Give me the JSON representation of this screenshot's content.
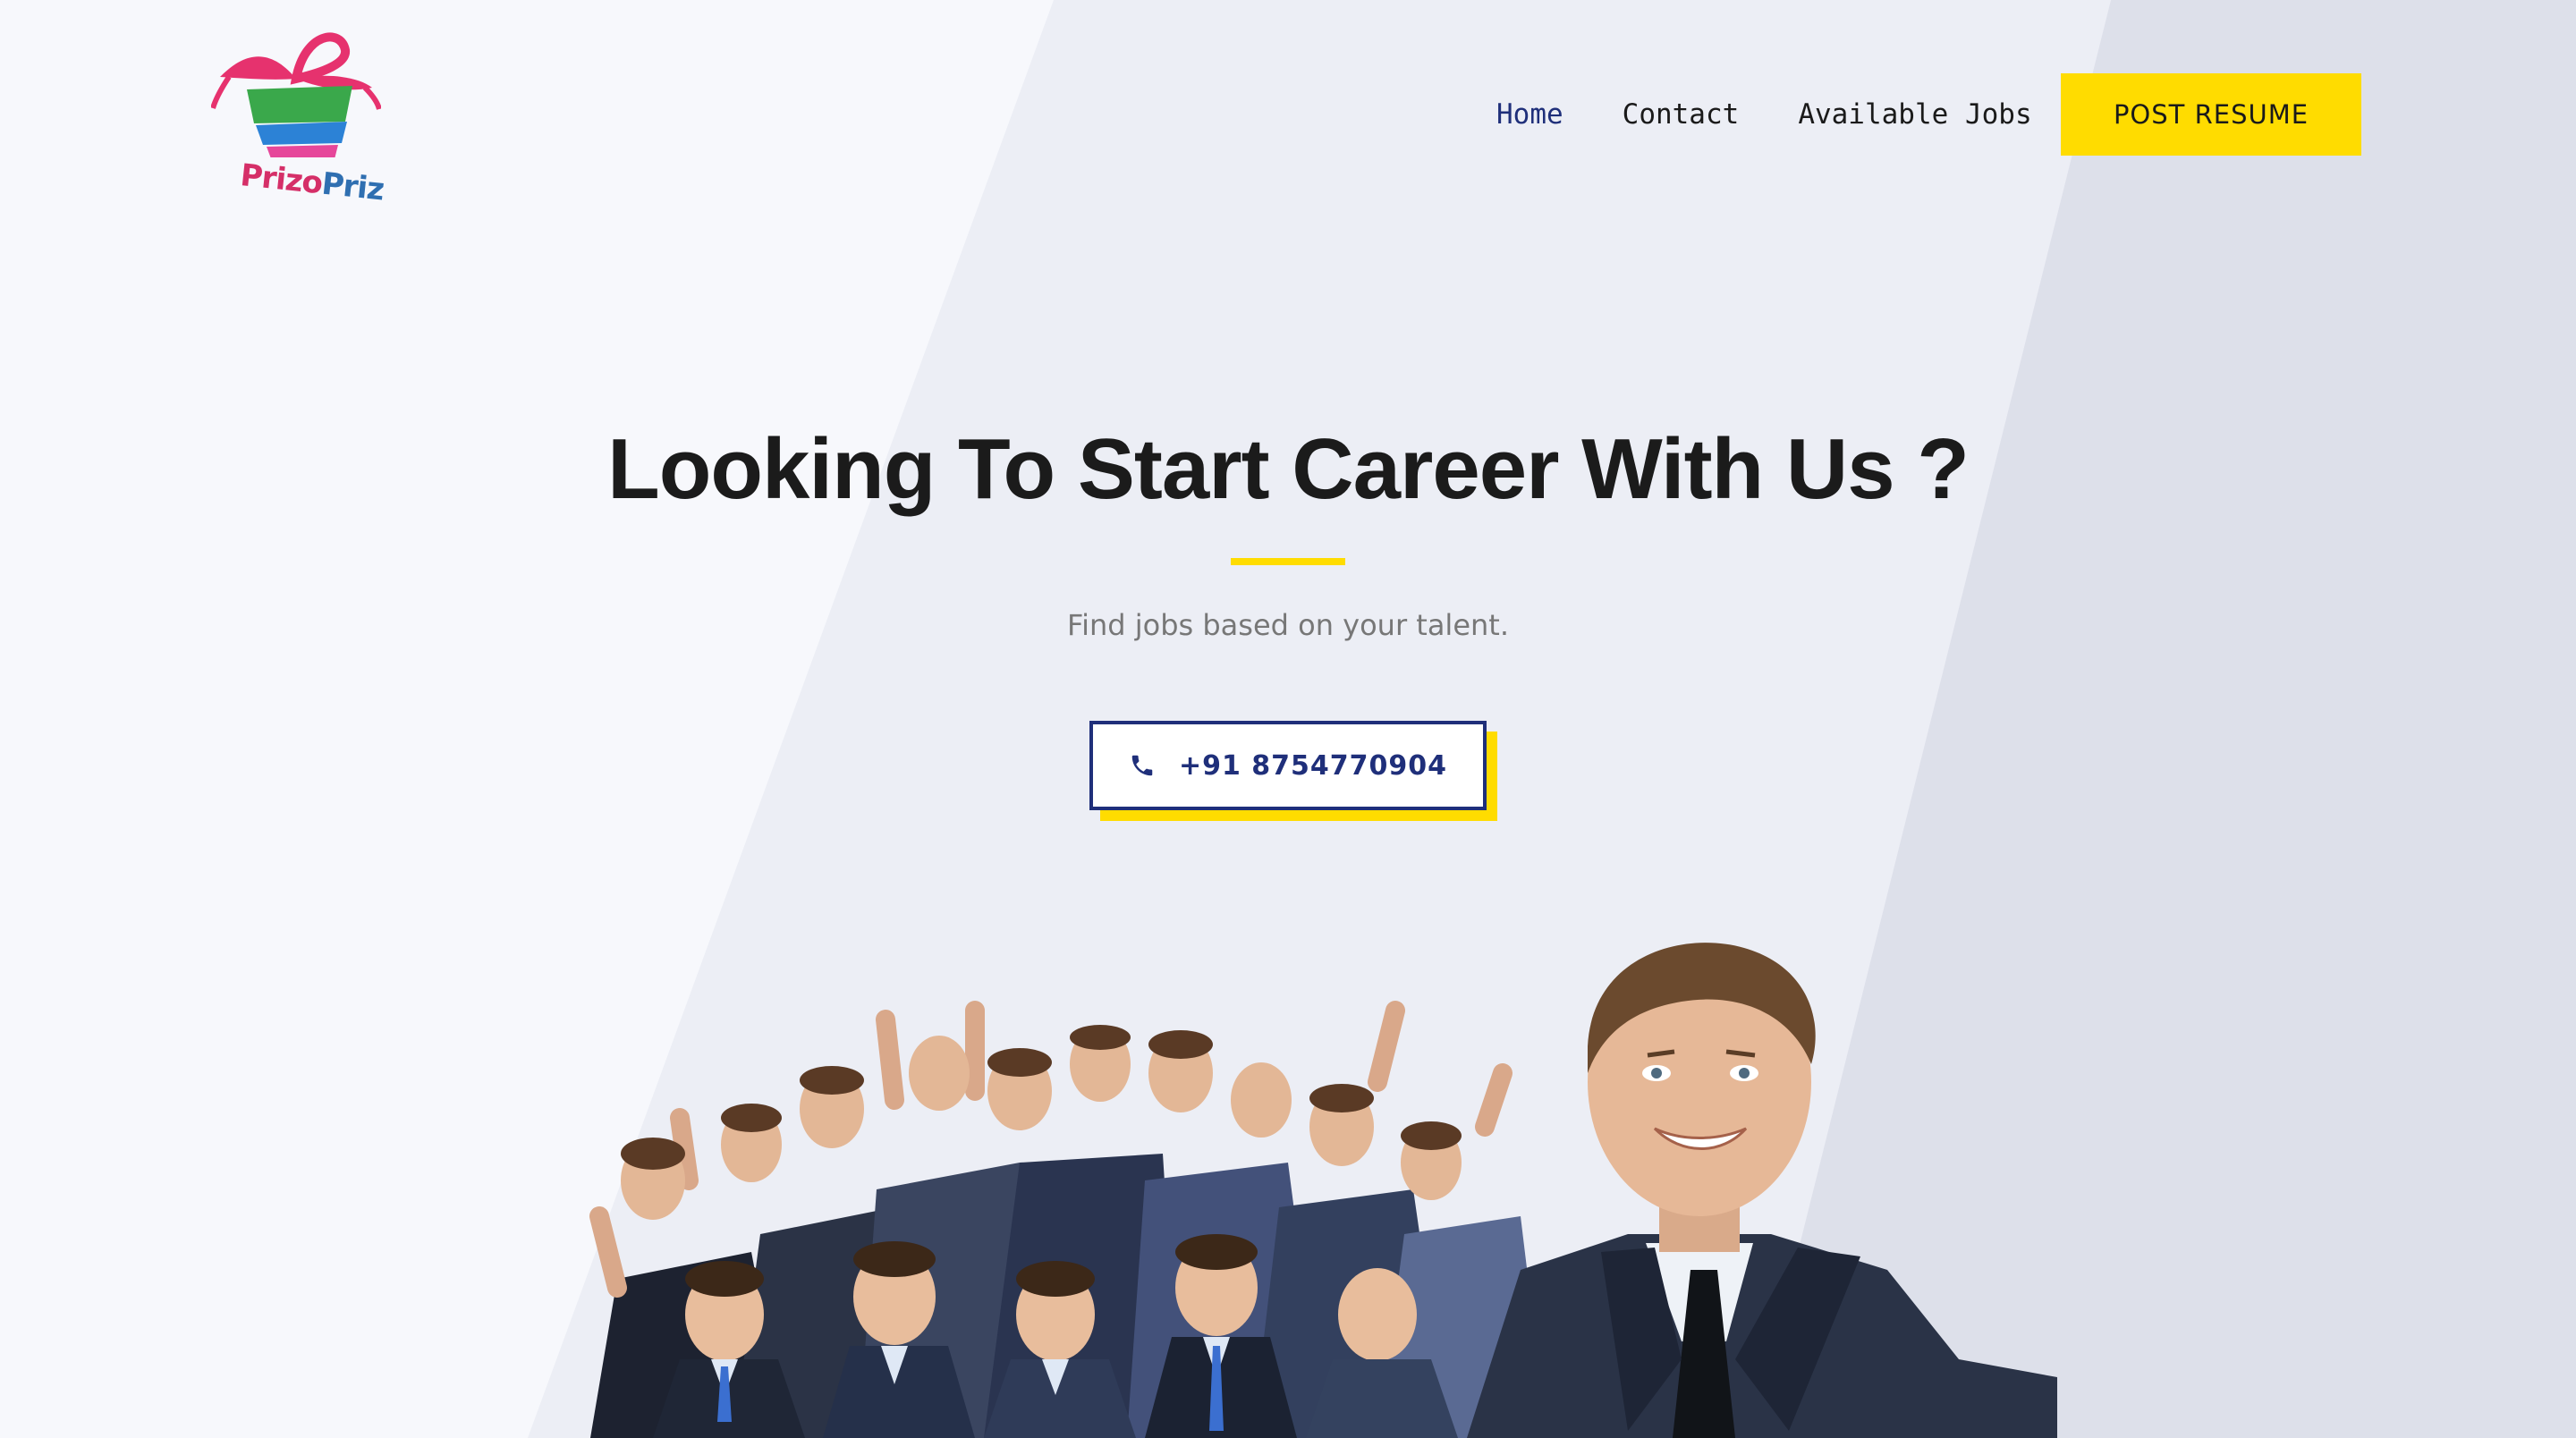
{
  "colors": {
    "accent": "#ffdc00",
    "primary": "#1f2f7a",
    "text": "#1b1b1b",
    "muted": "#777777",
    "background_left": "#f7f8fc",
    "background_mid": "#eceef5",
    "background_right": "#dde0ea"
  },
  "logo": {
    "part1": "Prizo",
    "part2": "Priz",
    "icon": "gift-box-icon"
  },
  "nav": {
    "items": [
      {
        "label": "Home",
        "active": true
      },
      {
        "label": "Contact",
        "active": false
      },
      {
        "label": "Available Jobs",
        "active": false
      }
    ],
    "cta_label": "POST RESUME"
  },
  "hero": {
    "title": "Looking To Start Career With Us ?",
    "subtitle": "Find jobs based on your talent.",
    "phone_label": "+91 8754770904",
    "phone_icon": "phone-icon"
  },
  "illustration": {
    "name": "celebrating-business-team-photo"
  }
}
